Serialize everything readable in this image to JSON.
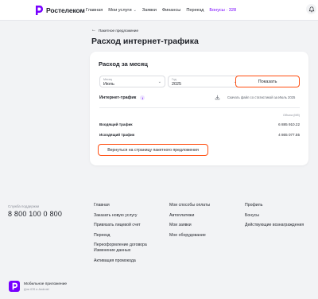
{
  "brand": {
    "name": "Ростелеком",
    "color": "#7700ff"
  },
  "accent_color": "#ff4f12",
  "nav": {
    "items": [
      "Главная",
      "Мои услуги",
      "Заявки",
      "Финансы",
      "Переезд"
    ],
    "bonus": "Бонусы · 328"
  },
  "header": {
    "bell_icon": "bell-icon"
  },
  "breadcrumb": {
    "back_label": "Пакетное предложение"
  },
  "page": {
    "title": "Расход интернет-трафика"
  },
  "card": {
    "title": "Расход за месяц",
    "month": {
      "label": "Месяц",
      "value": "Июль"
    },
    "year": {
      "label": "Год",
      "value": "2025"
    },
    "show_button": "Показать",
    "traffic_label": "Интернет-трафик",
    "info_symbol": "i",
    "download_label": "Скачать файл со статистикой за Июль 2025",
    "volume_caption": "Объем (Мб)",
    "incoming": {
      "label": "Входящий трафик",
      "value": "6 885 910.22"
    },
    "outgoing": {
      "label": "Исходящий трафик",
      "value": "4 865 077.55"
    },
    "return_button": "Вернуться на страницу пакетного предложения"
  },
  "footer": {
    "support_caption": "Служба поддержки",
    "support_phone": "8 800 100 0 800",
    "col1": [
      "Главная",
      "Заказать новую услугу",
      "Привязать лицевой счет",
      "Переезд",
      "Переоформление договора",
      "Изменение данных",
      "Активация промокода"
    ],
    "col2": [
      "Мои способы оплаты",
      "Автоплатежи",
      "Мои заявки",
      "Мое оборудование"
    ],
    "col3": [
      "Профиль",
      "Бонусы",
      "Действующие вознаграждения"
    ],
    "app_title": "Мобильное приложение",
    "app_sub": "Для iOS и Android"
  }
}
